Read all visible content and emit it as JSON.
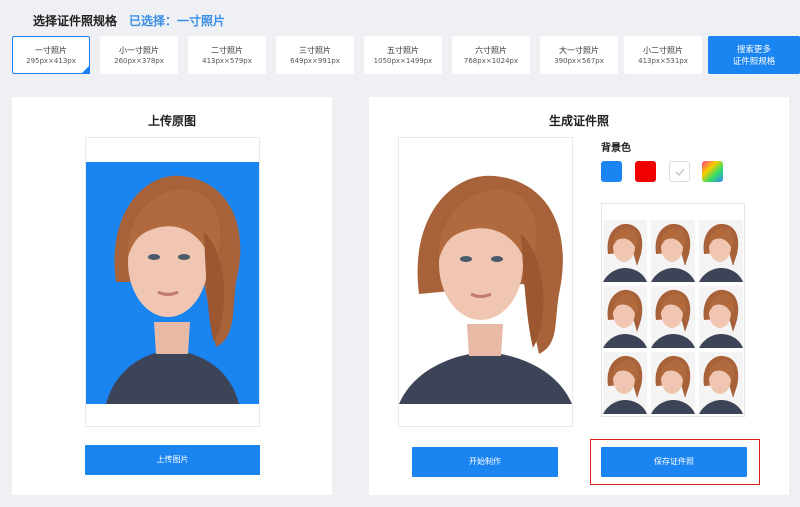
{
  "header": {
    "title": "选择证件照规格",
    "selected": "已选择：一寸照片"
  },
  "specs": [
    {
      "name": "一寸照片",
      "size": "295px×413px",
      "active": true
    },
    {
      "name": "小一寸照片",
      "size": "260px×378px"
    },
    {
      "name": "二寸照片",
      "size": "413px×579px"
    },
    {
      "name": "三寸照片",
      "size": "649px×991px"
    },
    {
      "name": "五寸照片",
      "size": "1050px×1499px"
    },
    {
      "name": "六寸照片",
      "size": "768px×1024px"
    },
    {
      "name": "大一寸照片",
      "size": "390px×567px"
    },
    {
      "name": "小二寸照片",
      "size": "413px×531px"
    }
  ],
  "more_button": {
    "line1": "搜索更多",
    "line2": "证件照规格"
  },
  "upload_panel": {
    "title": "上传原图",
    "button": "上传图片"
  },
  "result_panel": {
    "title": "生成证件照",
    "bg_label": "背景色",
    "bg_colors": [
      "#1a84f0",
      "#f00000",
      "#ffffff",
      "gradient"
    ],
    "start_button": "开始制作",
    "save_button": "保存证件照"
  },
  "colors": {
    "accent": "#1a84f0",
    "photo_bg_blue": "#1a84f0",
    "highlight": "#e02020"
  }
}
